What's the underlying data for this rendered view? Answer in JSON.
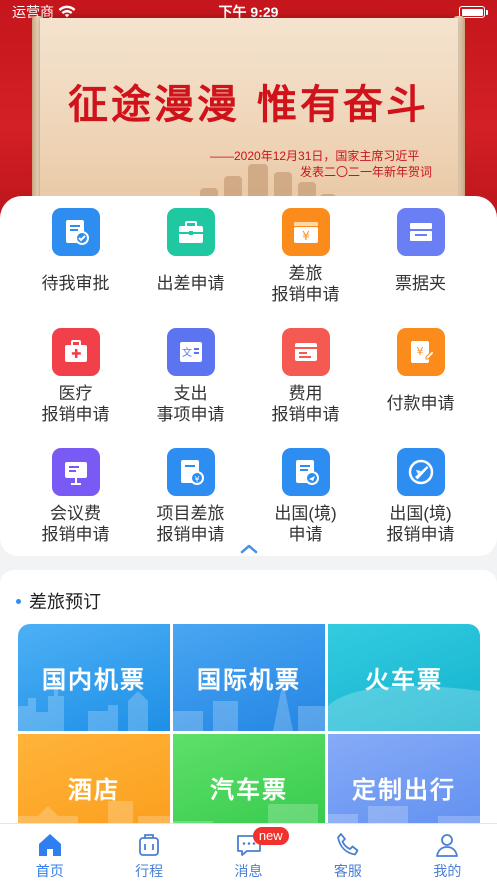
{
  "status_bar": {
    "carrier": "运营商",
    "time": "下午 9:29"
  },
  "banner": {
    "slogan": "征途漫漫 惟有奋斗",
    "quote_line1": "——2020年12月31日，国家主席习近平",
    "quote_line2": "发表二〇二一年新年贺词"
  },
  "functions": [
    {
      "label": "待我审批",
      "icon": "approval-icon",
      "color": "#2d8df0"
    },
    {
      "label": "出差申请",
      "icon": "briefcase-icon",
      "color": "#1fc8a0"
    },
    {
      "label": "差旅\n报销申请",
      "icon": "wallet-yuan-icon",
      "color": "#fb8c1b"
    },
    {
      "label": "票据夹",
      "icon": "ticket-folder-icon",
      "color": "#6b7ff5"
    },
    {
      "label": "医疗\n报销申请",
      "icon": "medical-kit-icon",
      "color": "#f2404a"
    },
    {
      "label": "支出\n事项申请",
      "icon": "expense-doc-icon",
      "color": "#5b74f0"
    },
    {
      "label": "费用\n报销申请",
      "icon": "invoice-icon",
      "color": "#f45a52"
    },
    {
      "label": "付款申请",
      "icon": "payment-ticket-icon",
      "color": "#fb8c1b"
    },
    {
      "label": "会议费\n报销申请",
      "icon": "presentation-icon",
      "color": "#7a5af5"
    },
    {
      "label": "项目差旅\n报销申请",
      "icon": "project-yuan-icon",
      "color": "#2d8df0"
    },
    {
      "label": "出国(境)\n申请",
      "icon": "abroad-doc-icon",
      "color": "#2d8df0"
    },
    {
      "label": "出国(境)\n报销申请",
      "icon": "plane-circle-icon",
      "color": "#2d8df0"
    }
  ],
  "booking": {
    "title": "差旅预订",
    "tiles": [
      "国内机票",
      "国际机票",
      "火车票",
      "酒店",
      "汽车票",
      "定制出行"
    ]
  },
  "tabbar": {
    "items": [
      {
        "label": "首页",
        "icon": "home-icon",
        "active": true
      },
      {
        "label": "行程",
        "icon": "luggage-icon",
        "active": false
      },
      {
        "label": "消息",
        "icon": "message-icon",
        "active": false,
        "badge": "new"
      },
      {
        "label": "客服",
        "icon": "phone-icon",
        "active": false
      },
      {
        "label": "我的",
        "icon": "user-icon",
        "active": false
      }
    ]
  }
}
